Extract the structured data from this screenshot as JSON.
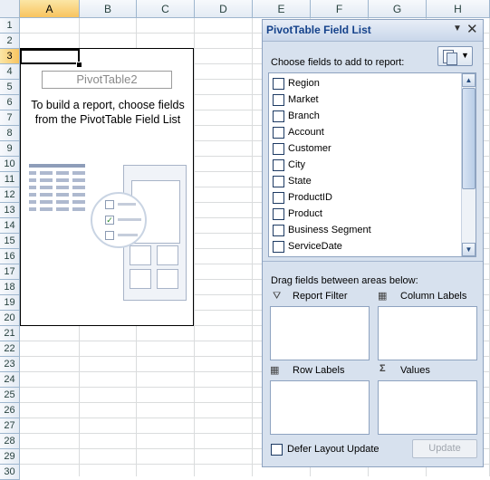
{
  "sheet": {
    "columns": [
      "A",
      "B",
      "C",
      "D",
      "E",
      "F",
      "G",
      "H"
    ],
    "selected_column": "A",
    "rows": [
      "1",
      "2",
      "3",
      "4",
      "5",
      "6",
      "7",
      "8",
      "9",
      "10",
      "11",
      "12",
      "13",
      "14",
      "15",
      "16",
      "17",
      "18",
      "19",
      "20",
      "21",
      "22",
      "23",
      "24",
      "25",
      "26",
      "27",
      "28",
      "29",
      "30"
    ],
    "selected_row": "3"
  },
  "pivot": {
    "name": "PivotTable2",
    "instruction_line1": "To build a report, choose fields",
    "instruction_line2": "from the PivotTable Field List"
  },
  "field_list": {
    "title": "PivotTable Field List",
    "dropdown_glyph": "▼",
    "close_glyph": "✕",
    "choose_label": "Choose fields to add to report:",
    "fields": [
      {
        "label": "Region",
        "checked": false
      },
      {
        "label": "Market",
        "checked": false
      },
      {
        "label": "Branch",
        "checked": false
      },
      {
        "label": "Account",
        "checked": false
      },
      {
        "label": "Customer",
        "checked": false
      },
      {
        "label": "City",
        "checked": false
      },
      {
        "label": "State",
        "checked": false
      },
      {
        "label": "ProductID",
        "checked": false
      },
      {
        "label": "Product",
        "checked": false
      },
      {
        "label": "Business Segment",
        "checked": false
      },
      {
        "label": "ServiceDate",
        "checked": false
      }
    ],
    "drag_label": "Drag fields between areas below:",
    "areas": {
      "report_filter": "Report Filter",
      "column_labels": "Column Labels",
      "row_labels": "Row Labels",
      "values": "Values"
    },
    "defer_label": "Defer Layout Update",
    "update_label": "Update"
  }
}
